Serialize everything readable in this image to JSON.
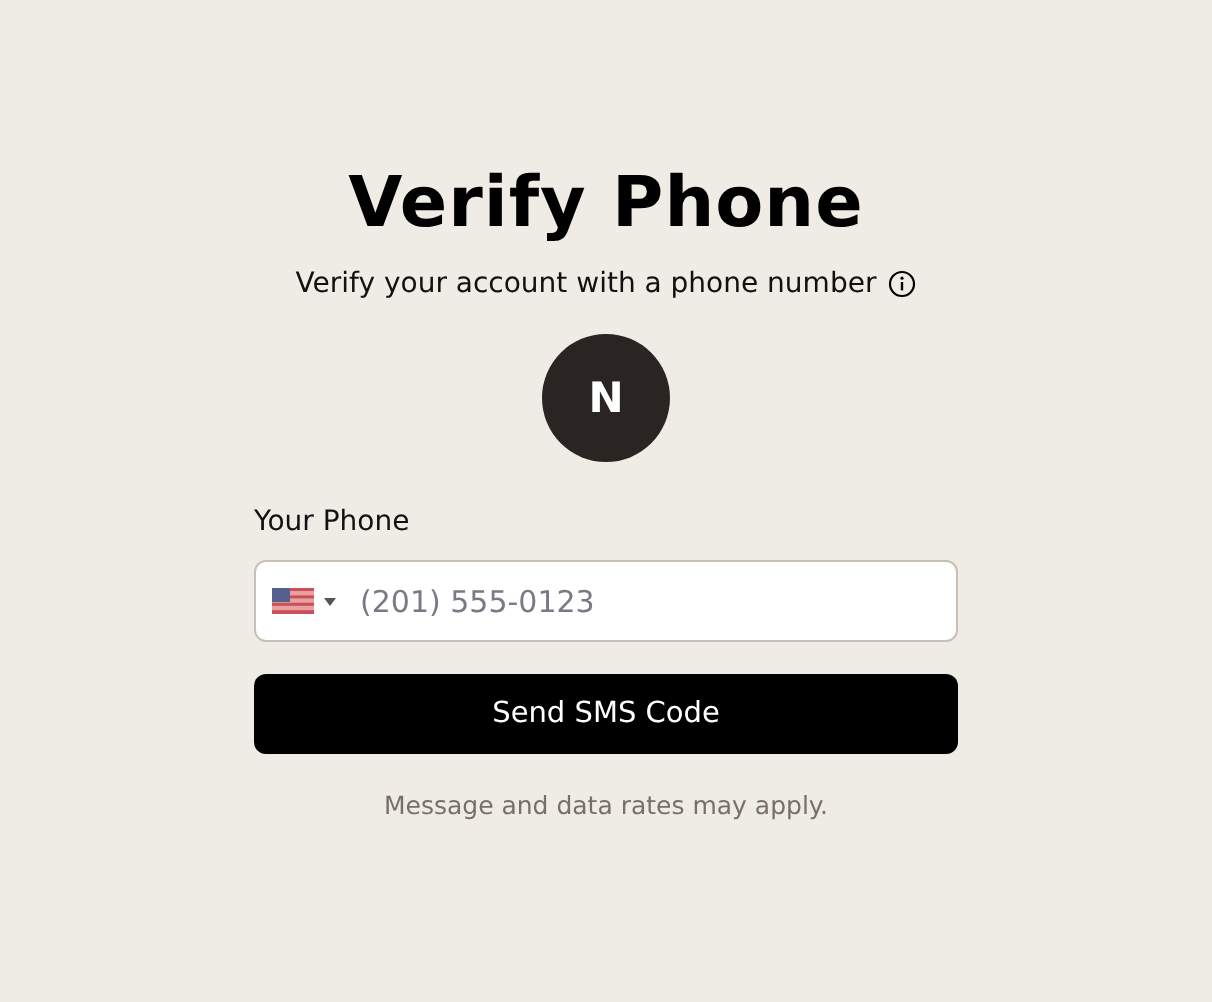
{
  "title": "Verify Phone",
  "subtitle": "Verify your account with a phone number",
  "avatar": {
    "initial": "N"
  },
  "phone_field": {
    "label": "Your Phone",
    "placeholder": "(201) 555-0123"
  },
  "submit_button": "Send SMS Code",
  "footnote": "Message and data rates may apply."
}
